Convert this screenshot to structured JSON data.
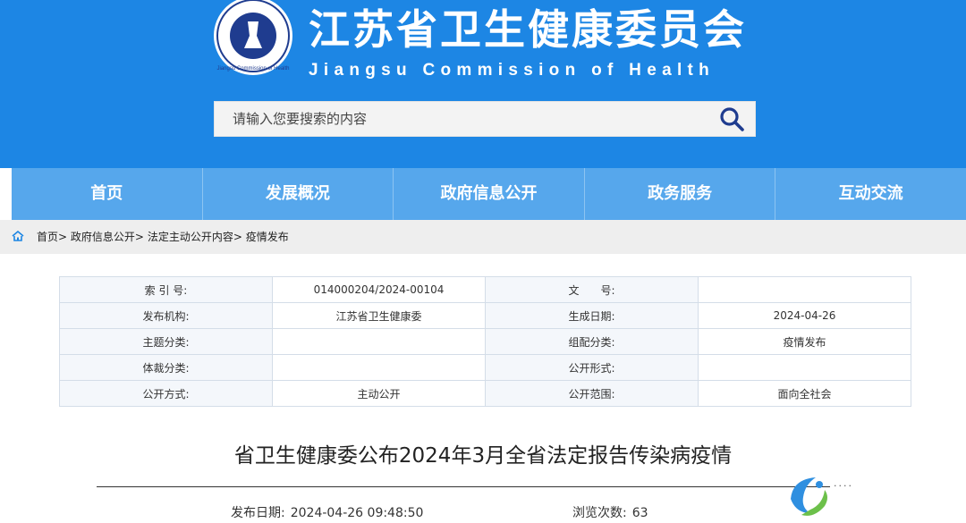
{
  "header": {
    "title": "江苏省卫生健康委员会",
    "subtitle": "Jiangsu Commission of Health",
    "emblem_text": "Jiangsu Commission of Health",
    "background_color": "#1d86e4"
  },
  "search": {
    "placeholder": "请输入您要搜索的内容",
    "icon": "search-icon",
    "icon_color": "#1f3c8f"
  },
  "nav": {
    "items": [
      {
        "label": "首页"
      },
      {
        "label": "发展概况"
      },
      {
        "label": "政府信息公开"
      },
      {
        "label": "政务服务"
      },
      {
        "label": "互动交流"
      }
    ]
  },
  "breadcrumb": {
    "icon": "home-icon",
    "items": [
      "首页",
      "政府信息公开",
      "法定主动公开内容",
      "疫情发布"
    ],
    "separator": ">"
  },
  "info_table": {
    "rows": [
      {
        "label1": "索 引 号:",
        "value1": "014000204/2024-00104",
        "label2": "文　　号:",
        "value2": ""
      },
      {
        "label1": "发布机构:",
        "value1": "江苏省卫生健康委",
        "label2": "生成日期:",
        "value2": "2024-04-26"
      },
      {
        "label1": "主题分类:",
        "value1": "",
        "label2": "组配分类:",
        "value2": "疫情发布"
      },
      {
        "label1": "体裁分类:",
        "value1": "",
        "label2": "公开形式:",
        "value2": ""
      },
      {
        "label1": "公开方式:",
        "value1": "主动公开",
        "label2": "公开范围:",
        "value2": "面向全社会"
      }
    ]
  },
  "article": {
    "title": "省卫生健康委公布2024年3月全省法定报告传染病疫情",
    "publish_label": "发布日期:",
    "publish_date": "2024-04-26 09:48:50",
    "views_label": "浏览次数:",
    "views": "63"
  }
}
